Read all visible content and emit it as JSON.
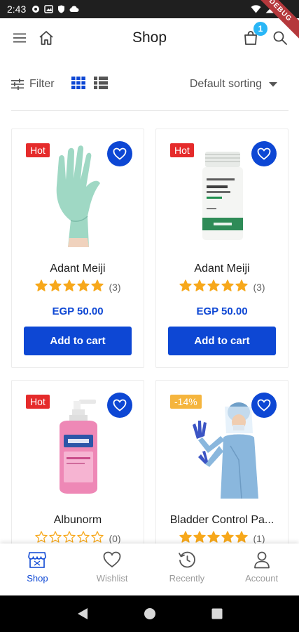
{
  "status_bar": {
    "time": "2:43",
    "debug_label": "DEBUG"
  },
  "app_bar": {
    "title": "Shop",
    "cart_count": "1"
  },
  "toolbar": {
    "filter_label": "Filter",
    "sort_label": "Default sorting"
  },
  "products": [
    {
      "name": "Adant Meiji",
      "badge": "Hot",
      "badge_type": "hot",
      "rating": 5,
      "review_count": "(3)",
      "price": "EGP 50.00",
      "cart_label": "Add to cart",
      "image": "gloves"
    },
    {
      "name": "Adant Meiji",
      "badge": "Hot",
      "badge_type": "hot",
      "rating": 5,
      "review_count": "(3)",
      "price": "EGP 50.00",
      "cart_label": "Add to cart",
      "image": "pill-bottle"
    },
    {
      "name": "Albunorm",
      "badge": "Hot",
      "badge_type": "hot",
      "rating": 0,
      "review_count": "(0)",
      "price": "",
      "cart_label": "",
      "image": "sanitizer"
    },
    {
      "name": "Bladder Control Pa...",
      "badge": "-14%",
      "badge_type": "sale",
      "rating": 5,
      "review_count": "(1)",
      "price": "",
      "cart_label": "",
      "image": "gown"
    }
  ],
  "bottom_nav": [
    {
      "label": "Shop",
      "icon": "shop-icon",
      "active": true
    },
    {
      "label": "Wishlist",
      "icon": "heart-icon",
      "active": false
    },
    {
      "label": "Recently",
      "icon": "history-icon",
      "active": false
    },
    {
      "label": "Account",
      "icon": "person-icon",
      "active": false
    }
  ],
  "colors": {
    "primary": "#0d47d4",
    "hot": "#e52b2b",
    "sale": "#f5b53e",
    "star": "#f7a81b",
    "badge": "#29b6f6"
  }
}
